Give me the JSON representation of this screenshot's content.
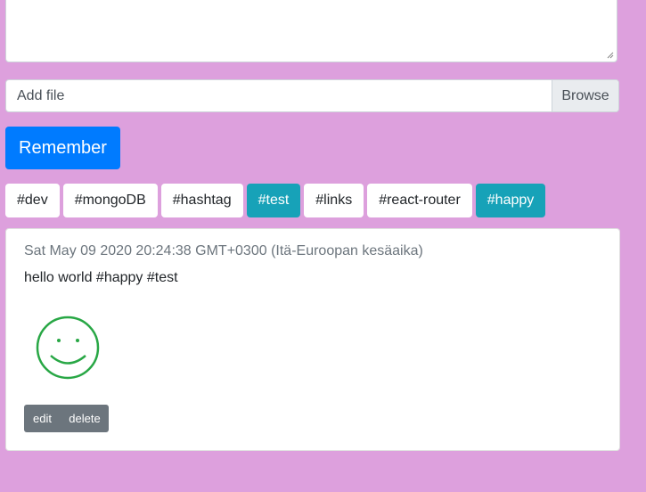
{
  "composer": {
    "file_label": "Add file",
    "browse_label": "Browse",
    "submit_label": "Remember"
  },
  "tags": [
    {
      "label": "#dev",
      "active": false
    },
    {
      "label": "#mongoDB",
      "active": false
    },
    {
      "label": "#hashtag",
      "active": false
    },
    {
      "label": "#test",
      "active": true
    },
    {
      "label": "#links",
      "active": false
    },
    {
      "label": "#react-router",
      "active": false
    },
    {
      "label": "#happy",
      "active": true
    }
  ],
  "post": {
    "date": "Sat May 09 2020 20:24:38 GMT+0300 (Itä-Euroopan kesäaika)",
    "text": "hello world #happy #test",
    "image_icon": "smiley-face-icon",
    "edit_label": "edit",
    "delete_label": "delete"
  },
  "colors": {
    "background": "#dda0dd",
    "primary": "#007bff",
    "tag_active": "#17a2b8",
    "secondary": "#6c757d",
    "smiley": "#28a745"
  }
}
